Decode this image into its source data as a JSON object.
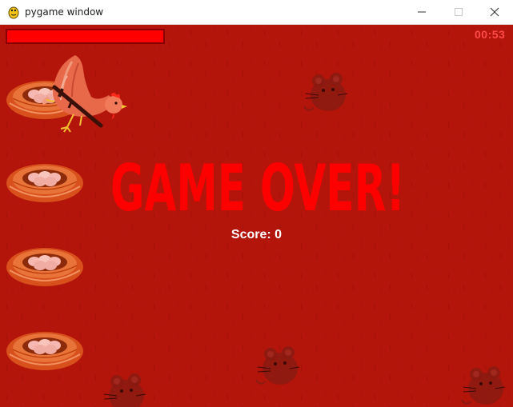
{
  "window": {
    "title": "pygame window",
    "icon": "pygame-snake-icon",
    "controls": [
      "minimize-icon",
      "maximize-icon",
      "close-icon"
    ]
  },
  "hud": {
    "timer": "00:53",
    "health_fraction": 1.0
  },
  "overlay": {
    "headline": "GAME OVER!",
    "score_label": "Score:",
    "score_value": "0"
  },
  "colors": {
    "background": "#b3150a",
    "headline": "#ff0000",
    "timer": "#ff4a4a",
    "health": "#ff0000",
    "score": "#ffffff"
  },
  "sprites": {
    "nests": 4,
    "player": "hen-with-rifle",
    "enemies": "mouse"
  }
}
